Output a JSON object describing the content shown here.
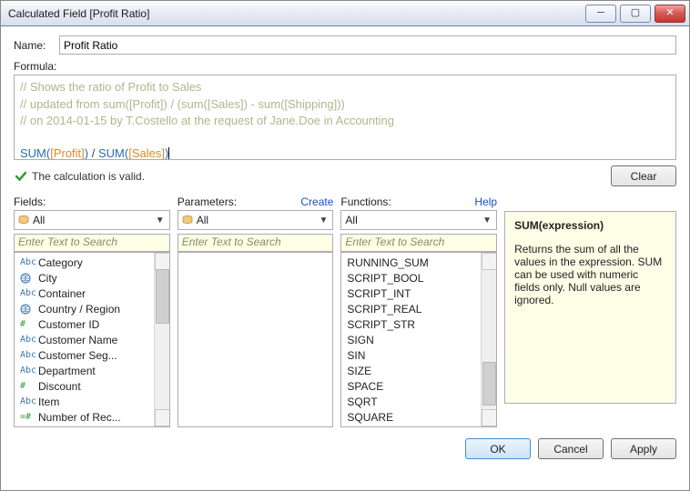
{
  "window": {
    "title": "Calculated Field [Profit Ratio]"
  },
  "name_row": {
    "label": "Name:",
    "value": "Profit Ratio"
  },
  "formula_row": {
    "label": "Formula:"
  },
  "formula": {
    "comment1": "// Shows the ratio of Profit to Sales",
    "comment2": "// updated from sum([Profit]) / (sum([Sales]) - sum([Shipping]))",
    "comment3": "// on 2014-01-15 by T.Costello at the request of Jane.Doe in Accounting",
    "func1": "SUM(",
    "field1": "[Profit]",
    "close1": ")",
    "op": " / ",
    "func2": "SUM(",
    "field2": "[Sales]",
    "close2": ")"
  },
  "status": {
    "text": "The calculation is valid."
  },
  "buttons": {
    "clear": "Clear",
    "ok": "OK",
    "cancel": "Cancel",
    "apply": "Apply"
  },
  "fields_panel": {
    "label": "Fields:",
    "combo_text": "All",
    "search_placeholder": "Enter Text to Search",
    "items": [
      {
        "type": "Abc",
        "text": "Category"
      },
      {
        "type": "globe",
        "text": "City"
      },
      {
        "type": "Abc",
        "text": "Container"
      },
      {
        "type": "globe",
        "text": "Country / Region"
      },
      {
        "type": "#",
        "text": "Customer ID"
      },
      {
        "type": "Abc",
        "text": "Customer Name"
      },
      {
        "type": "Abc",
        "text": "Customer Seg..."
      },
      {
        "type": "Abc",
        "text": "Department"
      },
      {
        "type": "#",
        "text": "Discount"
      },
      {
        "type": "Abc",
        "text": "Item"
      },
      {
        "type": "=#",
        "text": "Number of Rec..."
      }
    ]
  },
  "parameters_panel": {
    "label": "Parameters:",
    "create_link": "Create",
    "combo_text": "All",
    "search_placeholder": "Enter Text to Search"
  },
  "functions_panel": {
    "label": "Functions:",
    "help_link": "Help",
    "combo_text": "All",
    "search_placeholder": "Enter Text to Search",
    "items": [
      "RUNNING_SUM",
      "SCRIPT_BOOL",
      "SCRIPT_INT",
      "SCRIPT_REAL",
      "SCRIPT_STR",
      "SIGN",
      "SIN",
      "SIZE",
      "SPACE",
      "SQRT",
      "SQUARE"
    ]
  },
  "function_desc": {
    "signature": "SUM(expression)",
    "body": "Returns the sum of all the values in the expression. SUM can be used with numeric fields only. Null values are ignored."
  }
}
